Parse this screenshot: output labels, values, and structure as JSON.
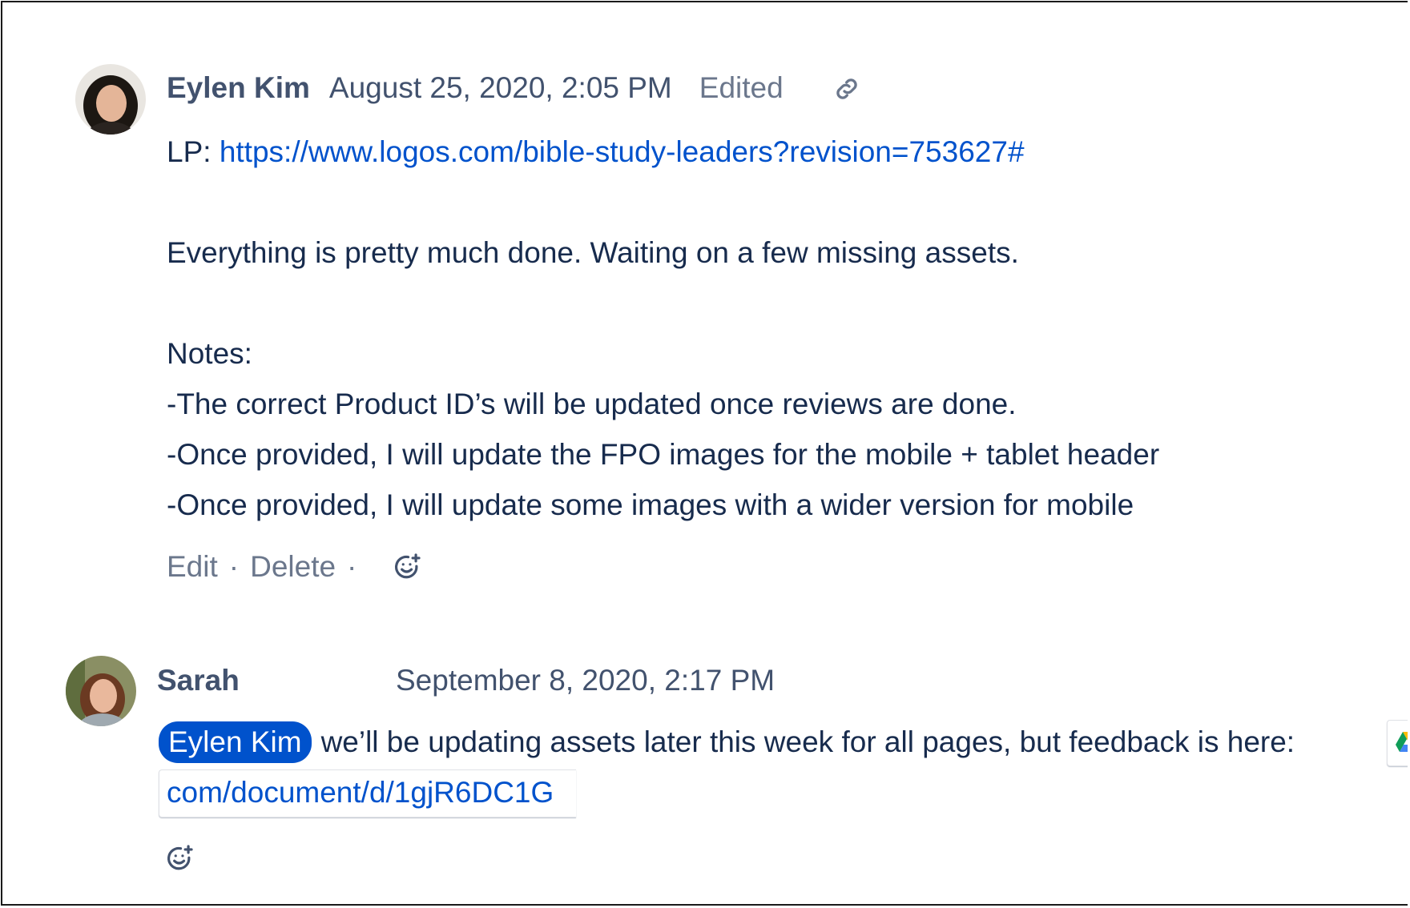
{
  "comments": [
    {
      "author": "Eylen Kim",
      "date": "August 25, 2020, 2:05 PM",
      "edited": "Edited",
      "link_prefix": "LP: ",
      "link_url": "https://www.logos.com/bible-study-leaders?revision=753627#",
      "paragraph": "Everything is pretty much done. Waiting on a few missing assets.",
      "notes_heading": "Notes:",
      "notes": [
        "-The correct Product ID’s will be updated once reviews are done.",
        "-Once provided, I will update the FPO images for the mobile + tablet header",
        "-Once provided, I will update some images with a wider version for mobile"
      ],
      "actions": {
        "edit": "Edit",
        "separator": "·",
        "delete": "Delete"
      }
    },
    {
      "author": "Sarah",
      "date": "September 8, 2020, 2:17 PM",
      "mention": "Eylen Kim",
      "message": "we’ll be updating assets later this week for all pages, but feedback is here:",
      "smart_link_text": "com/document/d/1gjR6DC1G"
    }
  ],
  "icons": {
    "permalink": "link-icon",
    "add_reaction": "emoji-add-icon",
    "google_drive": "google-drive-icon"
  },
  "colors": {
    "link": "#0052cc",
    "mention_bg": "#0052cc",
    "text": "#172b4d",
    "meta": "#42526e",
    "muted": "#6b778c"
  }
}
